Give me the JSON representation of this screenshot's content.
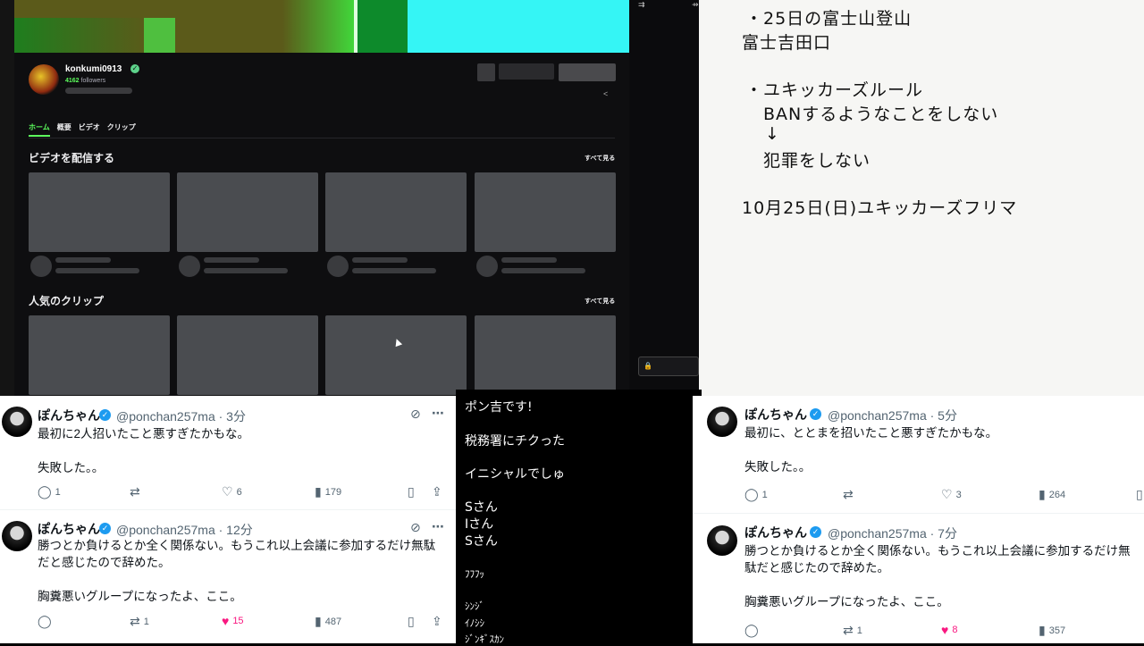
{
  "stream": {
    "channel_name": "konkumi0913",
    "followers_count": "4162",
    "followers_label": "followers",
    "tabs": [
      "ホーム",
      "概要",
      "ビデオ",
      "クリップ"
    ],
    "active_tab": "ホーム",
    "section_videos": "ビデオを配信する",
    "section_clips": "人気のクリップ",
    "see_all": "すべて見る"
  },
  "whiteboard": {
    "lines": [
      "・25日の富士山登山",
      "富士吉田口",
      "・ユキッカーズルール",
      "BANするようなことをしない",
      "↓",
      "犯罪をしない",
      "10月25日(日)ユキッカーズフリマ"
    ]
  },
  "tweets_left": [
    {
      "name": "ぽんちゃん",
      "handle": "@ponchan257ma · 3分",
      "text": "最初に2人招いたこと悪すぎたかもな。\n\n失敗した。。",
      "replies": "1",
      "retweets": "",
      "likes": "6",
      "views": "179",
      "liked": false
    },
    {
      "name": "ぽんちゃん",
      "handle": "@ponchan257ma · 12分",
      "text": "勝つとか負けるとか全く関係ない。もうこれ以上会議に参加するだけ無駄だと感じたので辞めた。\n\n胸糞悪いグループになったよ、ここ。",
      "replies": "",
      "retweets": "1",
      "likes": "15",
      "views": "487",
      "liked": true
    }
  ],
  "tweets_right": [
    {
      "name": "ぽんちゃん",
      "handle": "@ponchan257ma · 5分",
      "text": "最初に、ととまを招いたこと悪すぎたかもな。\n\n失敗した。。",
      "replies": "1",
      "retweets": "",
      "likes": "3",
      "views": "264",
      "liked": false
    },
    {
      "name": "ぽんちゃん",
      "handle": "@ponchan257ma · 7分",
      "text": "勝つとか負けるとか全く関係ない。もうこれ以上会議に参加するだけ無駄だと感じたので辞めた。\n\n胸糞悪いグループになったよ、ここ。",
      "replies": "",
      "retweets": "1",
      "likes": "8",
      "views": "357",
      "liked": true
    }
  ],
  "mid_panel": {
    "lines": [
      "ポン吉です!",
      "税務署にチクった",
      "イニシャルでしゅ",
      "Sさん",
      "Iさん",
      "Sさん",
      "ﾌﾌﾌｯ",
      "ｼﾝｼﾞ",
      "ｲﾉｼｼ",
      "ｼﾞﾝｷﾞｽｶﾝ"
    ]
  },
  "colors": {
    "accent_green": "#5dff5d",
    "like_pink": "#f91880",
    "verified_blue": "#1d9bf0"
  },
  "icons": [
    "verified-icon",
    "share-icon",
    "reply-icon",
    "retweet-icon",
    "heart-icon",
    "views-icon",
    "bookmark-icon",
    "upload-icon",
    "grok-icon",
    "more-icon",
    "lock-icon"
  ]
}
